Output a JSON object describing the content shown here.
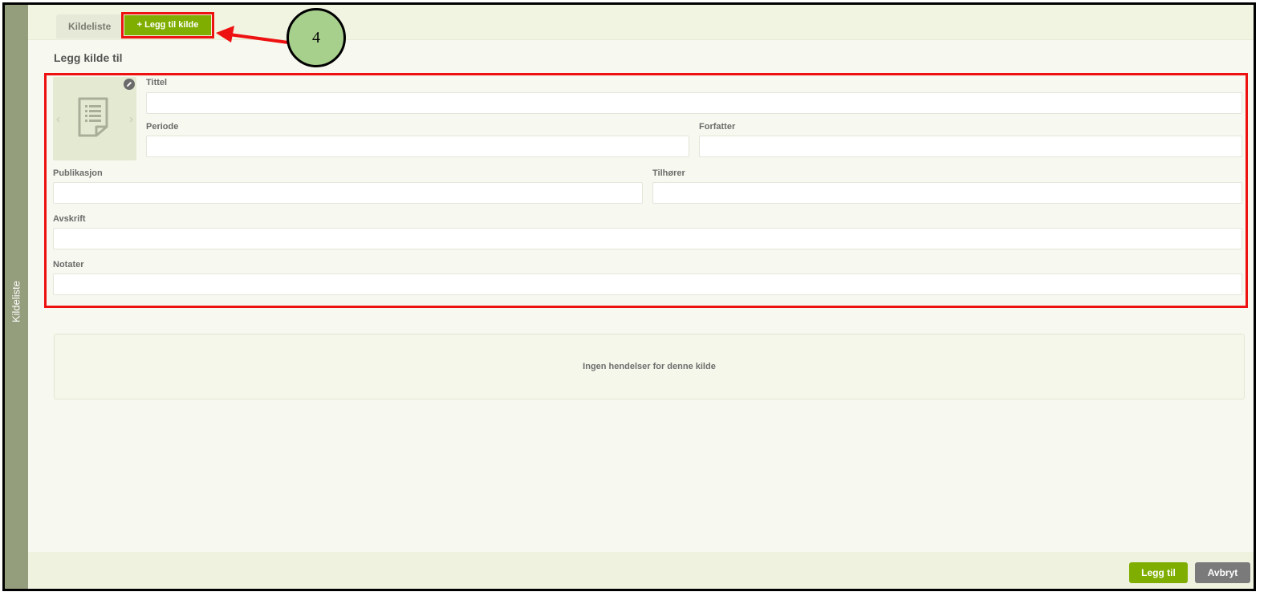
{
  "side_rail": {
    "label": "Kildeliste"
  },
  "tabs": {
    "list_label": "Kildeliste",
    "add_label": "+ Legg til kilde"
  },
  "annotation": {
    "step_number": "4"
  },
  "page": {
    "title": "Legg kilde til"
  },
  "form": {
    "title_label": "Tittel",
    "title_value": "",
    "period_label": "Periode",
    "period_value": "",
    "author_label": "Forfatter",
    "author_value": "",
    "publication_label": "Publikasjon",
    "publication_value": "",
    "belongs_label": "Tilhører",
    "belongs_value": "",
    "transcript_label": "Avskrift",
    "transcript_value": "",
    "notes_label": "Notater",
    "notes_value": ""
  },
  "events": {
    "empty_message": "Ingen hendelser for denne kilde"
  },
  "footer": {
    "add_button": "Legg til",
    "cancel_button": "Avbryt"
  },
  "colors": {
    "accent": "#7fae00",
    "highlight": "#ee1111",
    "rail": "#949d7c",
    "badge": "#a8d08d"
  }
}
